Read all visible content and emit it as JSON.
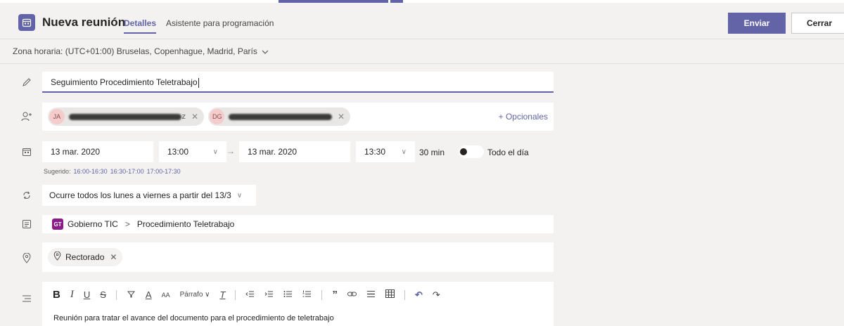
{
  "header": {
    "title": "Nueva reunión",
    "tabs": [
      {
        "label": "Detalles",
        "active": true
      },
      {
        "label": "Asistente para programación",
        "active": false
      }
    ],
    "send_label": "Enviar",
    "close_label": "Cerrar"
  },
  "timezone": {
    "label": "Zona horaria: (UTC+01:00) Bruselas, Copenhague, Madrid, París"
  },
  "meeting_title": {
    "value": "Seguimiento Procedimiento Teletrabajo"
  },
  "attendees": {
    "items": [
      {
        "initials": "JA",
        "name_visible": "z"
      },
      {
        "initials": "DG"
      }
    ],
    "optional_label": "+ Opcionales"
  },
  "schedule": {
    "start_date": "13 mar. 2020",
    "start_time": "13:00",
    "end_date": "13 mar. 2020",
    "end_time": "13:30",
    "duration": "30 min",
    "all_day_label": "Todo el día",
    "all_day_on": false,
    "suggested_label": "Sugerido:",
    "suggestions": [
      "16:00-16:30",
      "16:30-17:00",
      "17:00-17:30"
    ]
  },
  "recurrence": {
    "label": "Ocurre todos los lunes a viernes a partir del 13/3"
  },
  "channel": {
    "team_badge": "GT",
    "team": "Gobierno TIC",
    "separator": ">",
    "channel": "Procedimiento Teletrabajo"
  },
  "location": {
    "value": "Rectorado"
  },
  "editor": {
    "paragraph_label": "Párrafo",
    "body": "Reunión para tratar el avance del documento para el procedimiento de teletrabajo"
  },
  "colors": {
    "accent": "#6264a7",
    "background": "#f3f2f1",
    "field": "#ffffff"
  }
}
